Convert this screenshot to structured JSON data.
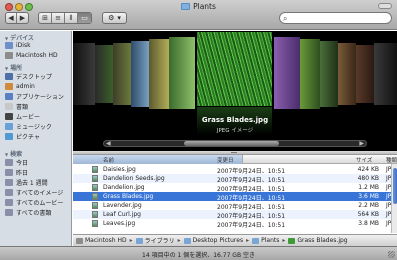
{
  "window": {
    "title": "Plants",
    "status": "14 項目中の 1 個を選択、16.77 GB 空き"
  },
  "toolbar": {
    "nav": [
      {
        "label": "◀",
        "icon": "back-icon"
      },
      {
        "label": "▶",
        "icon": "forward-icon"
      }
    ],
    "views": [
      {
        "label": "⊞",
        "icon": "icon-view-icon"
      },
      {
        "label": "≡",
        "icon": "list-view-icon"
      },
      {
        "label": "⫴",
        "icon": "column-view-icon"
      },
      {
        "label": "▭",
        "icon": "coverflow-view-icon"
      }
    ],
    "action": {
      "label": "⚙",
      "arrow": "▾"
    },
    "search": {
      "placeholder": "",
      "icon": "⌕"
    }
  },
  "sidebar": {
    "devices_header": "デバイス",
    "devices": [
      {
        "label": "iDisk",
        "color": "#6e8fc8"
      },
      {
        "label": "Macintosh HD",
        "color": "#8c8c8c"
      }
    ],
    "places_header": "場所",
    "places": [
      {
        "label": "デスクトップ",
        "color": "#4c6fa8"
      },
      {
        "label": "admin",
        "color": "#d08a3c"
      },
      {
        "label": "アプリケーション",
        "color": "#5b7fc4"
      },
      {
        "label": "書類",
        "color": "#c7c7c7"
      },
      {
        "label": "ムービー",
        "color": "#444444"
      },
      {
        "label": "ミュージック",
        "color": "#6aa0d8"
      },
      {
        "label": "ピクチャ",
        "color": "#4f9ad1"
      }
    ],
    "search_header": "検索",
    "searches": [
      {
        "label": "今日",
        "color": "#8a8fa8"
      },
      {
        "label": "昨日",
        "color": "#8a8fa8"
      },
      {
        "label": "過去 1 週間",
        "color": "#8a8fa8"
      },
      {
        "label": "すべてのイメージ",
        "color": "#8a8fa8"
      },
      {
        "label": "すべてのムービー",
        "color": "#8a8fa8"
      },
      {
        "label": "すべての書類",
        "color": "#8a8fa8"
      }
    ]
  },
  "coverflow": {
    "title": "Grass Blades.jpg",
    "subtitle": "JPEG イメージ",
    "left_arrow": "◀",
    "right_arrow": "▶"
  },
  "list": {
    "headers": {
      "name": "名前",
      "date": "変更日",
      "size": "サイズ",
      "kind": "種類"
    },
    "rows": [
      {
        "name": "Daisies.jpg",
        "date": "2007年9月24日、10:51",
        "size": "424 KB",
        "kind": "JP",
        "selected": false
      },
      {
        "name": "Dandelion Seeds.jpg",
        "date": "2007年9月24日、10:51",
        "size": "480 KB",
        "kind": "JP",
        "selected": false
      },
      {
        "name": "Dandelion.jpg",
        "date": "2007年9月24日、10:51",
        "size": "1.2 MB",
        "kind": "JP",
        "selected": false
      },
      {
        "name": "Grass Blades.jpg",
        "date": "2007年9月24日、10:51",
        "size": "3.6 MB",
        "kind": "JP",
        "selected": true
      },
      {
        "name": "Lavender.jpg",
        "date": "2007年9月24日、10:51",
        "size": "2.2 MB",
        "kind": "JP",
        "selected": false
      },
      {
        "name": "Leaf Curl.jpg",
        "date": "2007年9月24日、10:51",
        "size": "564 KB",
        "kind": "JP",
        "selected": false
      },
      {
        "name": "Leaves.jpg",
        "date": "2007年9月24日、10:51",
        "size": "3.8 MB",
        "kind": "JP",
        "selected": false
      }
    ]
  },
  "pathbar": {
    "segments": [
      {
        "label": "Macintosh HD",
        "color": "#8c8c8c"
      },
      {
        "label": "ライブラリ",
        "color": "#7aa6d6"
      },
      {
        "label": "Desktop Pictures",
        "color": "#7aa6d6"
      },
      {
        "label": "Plants",
        "color": "#7aa6d6"
      },
      {
        "label": "Grass Blades.jpg",
        "color": "#3f9a38"
      }
    ],
    "separator": "▸"
  }
}
